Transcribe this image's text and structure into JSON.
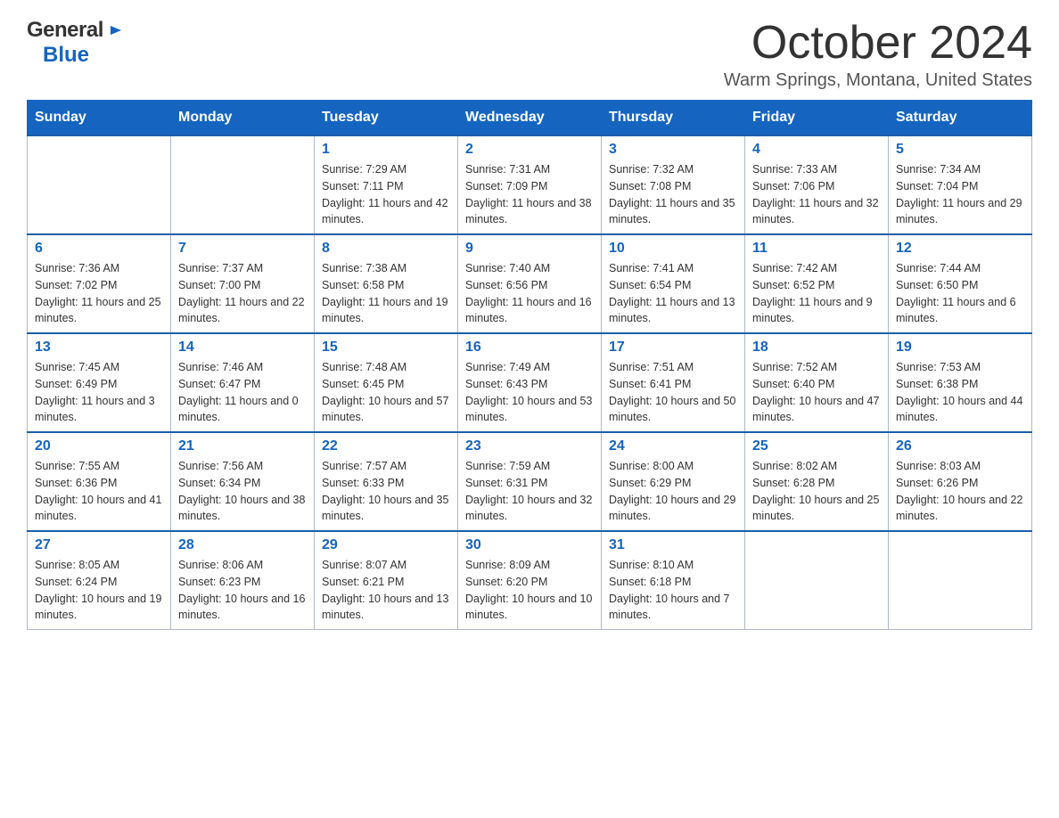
{
  "header": {
    "logo_general": "General",
    "logo_blue": "Blue",
    "month": "October 2024",
    "location": "Warm Springs, Montana, United States"
  },
  "weekdays": [
    "Sunday",
    "Monday",
    "Tuesday",
    "Wednesday",
    "Thursday",
    "Friday",
    "Saturday"
  ],
  "weeks": [
    [
      {
        "day": "",
        "sunrise": "",
        "sunset": "",
        "daylight": ""
      },
      {
        "day": "",
        "sunrise": "",
        "sunset": "",
        "daylight": ""
      },
      {
        "day": "1",
        "sunrise": "Sunrise: 7:29 AM",
        "sunset": "Sunset: 7:11 PM",
        "daylight": "Daylight: 11 hours and 42 minutes."
      },
      {
        "day": "2",
        "sunrise": "Sunrise: 7:31 AM",
        "sunset": "Sunset: 7:09 PM",
        "daylight": "Daylight: 11 hours and 38 minutes."
      },
      {
        "day": "3",
        "sunrise": "Sunrise: 7:32 AM",
        "sunset": "Sunset: 7:08 PM",
        "daylight": "Daylight: 11 hours and 35 minutes."
      },
      {
        "day": "4",
        "sunrise": "Sunrise: 7:33 AM",
        "sunset": "Sunset: 7:06 PM",
        "daylight": "Daylight: 11 hours and 32 minutes."
      },
      {
        "day": "5",
        "sunrise": "Sunrise: 7:34 AM",
        "sunset": "Sunset: 7:04 PM",
        "daylight": "Daylight: 11 hours and 29 minutes."
      }
    ],
    [
      {
        "day": "6",
        "sunrise": "Sunrise: 7:36 AM",
        "sunset": "Sunset: 7:02 PM",
        "daylight": "Daylight: 11 hours and 25 minutes."
      },
      {
        "day": "7",
        "sunrise": "Sunrise: 7:37 AM",
        "sunset": "Sunset: 7:00 PM",
        "daylight": "Daylight: 11 hours and 22 minutes."
      },
      {
        "day": "8",
        "sunrise": "Sunrise: 7:38 AM",
        "sunset": "Sunset: 6:58 PM",
        "daylight": "Daylight: 11 hours and 19 minutes."
      },
      {
        "day": "9",
        "sunrise": "Sunrise: 7:40 AM",
        "sunset": "Sunset: 6:56 PM",
        "daylight": "Daylight: 11 hours and 16 minutes."
      },
      {
        "day": "10",
        "sunrise": "Sunrise: 7:41 AM",
        "sunset": "Sunset: 6:54 PM",
        "daylight": "Daylight: 11 hours and 13 minutes."
      },
      {
        "day": "11",
        "sunrise": "Sunrise: 7:42 AM",
        "sunset": "Sunset: 6:52 PM",
        "daylight": "Daylight: 11 hours and 9 minutes."
      },
      {
        "day": "12",
        "sunrise": "Sunrise: 7:44 AM",
        "sunset": "Sunset: 6:50 PM",
        "daylight": "Daylight: 11 hours and 6 minutes."
      }
    ],
    [
      {
        "day": "13",
        "sunrise": "Sunrise: 7:45 AM",
        "sunset": "Sunset: 6:49 PM",
        "daylight": "Daylight: 11 hours and 3 minutes."
      },
      {
        "day": "14",
        "sunrise": "Sunrise: 7:46 AM",
        "sunset": "Sunset: 6:47 PM",
        "daylight": "Daylight: 11 hours and 0 minutes."
      },
      {
        "day": "15",
        "sunrise": "Sunrise: 7:48 AM",
        "sunset": "Sunset: 6:45 PM",
        "daylight": "Daylight: 10 hours and 57 minutes."
      },
      {
        "day": "16",
        "sunrise": "Sunrise: 7:49 AM",
        "sunset": "Sunset: 6:43 PM",
        "daylight": "Daylight: 10 hours and 53 minutes."
      },
      {
        "day": "17",
        "sunrise": "Sunrise: 7:51 AM",
        "sunset": "Sunset: 6:41 PM",
        "daylight": "Daylight: 10 hours and 50 minutes."
      },
      {
        "day": "18",
        "sunrise": "Sunrise: 7:52 AM",
        "sunset": "Sunset: 6:40 PM",
        "daylight": "Daylight: 10 hours and 47 minutes."
      },
      {
        "day": "19",
        "sunrise": "Sunrise: 7:53 AM",
        "sunset": "Sunset: 6:38 PM",
        "daylight": "Daylight: 10 hours and 44 minutes."
      }
    ],
    [
      {
        "day": "20",
        "sunrise": "Sunrise: 7:55 AM",
        "sunset": "Sunset: 6:36 PM",
        "daylight": "Daylight: 10 hours and 41 minutes."
      },
      {
        "day": "21",
        "sunrise": "Sunrise: 7:56 AM",
        "sunset": "Sunset: 6:34 PM",
        "daylight": "Daylight: 10 hours and 38 minutes."
      },
      {
        "day": "22",
        "sunrise": "Sunrise: 7:57 AM",
        "sunset": "Sunset: 6:33 PM",
        "daylight": "Daylight: 10 hours and 35 minutes."
      },
      {
        "day": "23",
        "sunrise": "Sunrise: 7:59 AM",
        "sunset": "Sunset: 6:31 PM",
        "daylight": "Daylight: 10 hours and 32 minutes."
      },
      {
        "day": "24",
        "sunrise": "Sunrise: 8:00 AM",
        "sunset": "Sunset: 6:29 PM",
        "daylight": "Daylight: 10 hours and 29 minutes."
      },
      {
        "day": "25",
        "sunrise": "Sunrise: 8:02 AM",
        "sunset": "Sunset: 6:28 PM",
        "daylight": "Daylight: 10 hours and 25 minutes."
      },
      {
        "day": "26",
        "sunrise": "Sunrise: 8:03 AM",
        "sunset": "Sunset: 6:26 PM",
        "daylight": "Daylight: 10 hours and 22 minutes."
      }
    ],
    [
      {
        "day": "27",
        "sunrise": "Sunrise: 8:05 AM",
        "sunset": "Sunset: 6:24 PM",
        "daylight": "Daylight: 10 hours and 19 minutes."
      },
      {
        "day": "28",
        "sunrise": "Sunrise: 8:06 AM",
        "sunset": "Sunset: 6:23 PM",
        "daylight": "Daylight: 10 hours and 16 minutes."
      },
      {
        "day": "29",
        "sunrise": "Sunrise: 8:07 AM",
        "sunset": "Sunset: 6:21 PM",
        "daylight": "Daylight: 10 hours and 13 minutes."
      },
      {
        "day": "30",
        "sunrise": "Sunrise: 8:09 AM",
        "sunset": "Sunset: 6:20 PM",
        "daylight": "Daylight: 10 hours and 10 minutes."
      },
      {
        "day": "31",
        "sunrise": "Sunrise: 8:10 AM",
        "sunset": "Sunset: 6:18 PM",
        "daylight": "Daylight: 10 hours and 7 minutes."
      },
      {
        "day": "",
        "sunrise": "",
        "sunset": "",
        "daylight": ""
      },
      {
        "day": "",
        "sunrise": "",
        "sunset": "",
        "daylight": ""
      }
    ]
  ]
}
